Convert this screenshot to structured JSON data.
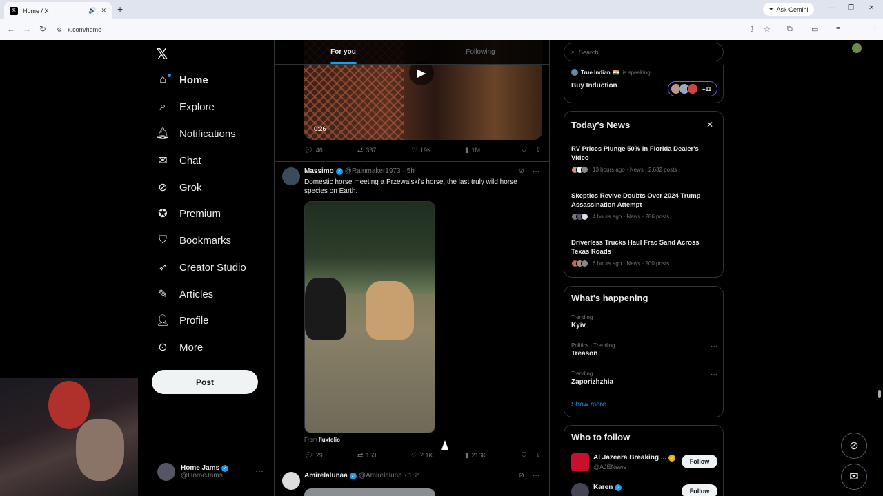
{
  "browser": {
    "tab_title": "Home / X",
    "url": "x.com/home",
    "gemini_label": "Ask Gemini"
  },
  "nav": {
    "items": [
      {
        "label": "Home",
        "icon": "home-icon"
      },
      {
        "label": "Explore",
        "icon": "search-icon"
      },
      {
        "label": "Notifications",
        "icon": "bell-icon"
      },
      {
        "label": "Chat",
        "icon": "mail-icon"
      },
      {
        "label": "Grok",
        "icon": "grok-icon"
      },
      {
        "label": "Premium",
        "icon": "verified-badge-icon"
      },
      {
        "label": "Bookmarks",
        "icon": "bookmark-icon"
      },
      {
        "label": "Creator Studio",
        "icon": "rocket-icon"
      },
      {
        "label": "Articles",
        "icon": "article-icon"
      },
      {
        "label": "Profile",
        "icon": "person-icon"
      },
      {
        "label": "More",
        "icon": "more-circle-icon"
      }
    ],
    "post_label": "Post",
    "me": {
      "name": "Home Jams",
      "handle": "@HomeJams"
    }
  },
  "timeline": {
    "tabs": [
      "For you",
      "Following"
    ],
    "video": {
      "duration": "0:26"
    },
    "tweet1_stats": {
      "replies": "46",
      "reposts": "337",
      "likes": "19K",
      "views": "1M"
    },
    "tweet2": {
      "name": "Massimo",
      "handle": "@Rainmaker1973",
      "time": "· 5h",
      "text": "Domestic horse meeting a Przewalski's horse, the last truly wild horse species on Earth.",
      "from_label": "From",
      "from_source": "fluxfolio",
      "replies": "29",
      "reposts": "153",
      "likes": "2.1K",
      "views": "216K"
    },
    "tweet3": {
      "name": "Amirelalunaa",
      "handle": "@Amirelaluna",
      "time": "· 18h"
    }
  },
  "right": {
    "search_placeholder": "Search",
    "space": {
      "host": "True Indian",
      "flag": "🇮🇳",
      "status": "is speaking",
      "title": "Buy Induction",
      "count": "+11"
    },
    "news": {
      "title": "Today's News",
      "items": [
        {
          "headline": "RV Prices Plunge 50% in Florida Dealer's Video",
          "meta": "13 hours ago · News · 2,632 posts"
        },
        {
          "headline": "Skeptics Revive Doubts Over 2024 Trump Assassination Attempt",
          "meta": "4 hours ago · News · 286 posts"
        },
        {
          "headline": "Driverless Trucks Haul Frac Sand Across Texas Roads",
          "meta": "6 hours ago · News · 500 posts"
        }
      ]
    },
    "happening": {
      "title": "What's happening",
      "trends": [
        {
          "context": "Trending",
          "name": "Kyiv"
        },
        {
          "context": "Politics · Trending",
          "name": "Treason"
        },
        {
          "context": "Trending",
          "name": "Zaporizhzhia"
        }
      ],
      "show_more": "Show more"
    },
    "who_to_follow": {
      "title": "Who to follow",
      "accounts": [
        {
          "name": "Al Jazeera Breaking ...",
          "handle": "@AJENews",
          "follow": "Follow"
        },
        {
          "name": "Karen",
          "handle": "",
          "follow": "Follow"
        }
      ]
    }
  },
  "colors": {
    "accent": "#1d9bf0",
    "bg": "#000000",
    "border": "#2f3336",
    "muted": "#71767b"
  }
}
